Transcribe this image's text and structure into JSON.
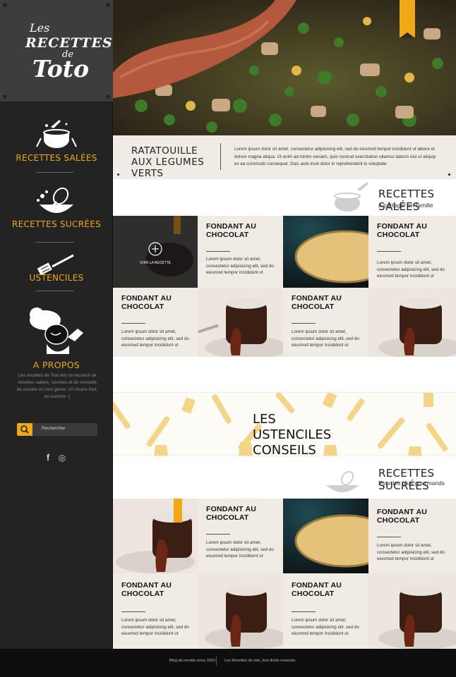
{
  "sidebar": {
    "logo": {
      "line1": "Les",
      "line2": "RECETTES",
      "line3": "de",
      "line4": "Toto"
    },
    "nav": [
      {
        "label": "RECETTES SALÉES",
        "icon": "cooking-pot-icon"
      },
      {
        "label": "RECETTES SUCRÉES",
        "icon": "whisk-bowl-icon"
      },
      {
        "label": "USTENCILES",
        "icon": "spatula-icon"
      },
      {
        "label": "A PROPOS",
        "icon": "chef-icon"
      }
    ],
    "about_text": "Les recettes de Toto est un recceuil de recettes salées, sucrées et de conseils de cuisine en tout genre. Un fourre tout, en somme :)",
    "search": {
      "placeholder": "Rechercher",
      "icon": "search-icon"
    },
    "social": [
      {
        "name": "facebook-icon",
        "glyph": "f"
      },
      {
        "name": "instagram-icon",
        "glyph": "◎"
      }
    ]
  },
  "feature": {
    "title": "RATATOUILLE AUX LEGUMES VERTS",
    "desc": "Lorem ipsum dolor sit amet, consectetur adipisicing elit, sed do eiusmod tempor incididunt ut labore et dolore magna aliqua. Ut enim ad minim veniam, quis nostrud exercitation ullamco laboris nisi ut aliquip ex ea commodo consequat. Duis aute irure dolor in reprehenderit in voluptate"
  },
  "sections": {
    "salees": {
      "title": "RECETTES SALÉES",
      "subtitle": "à partager en famille"
    },
    "ustenciles": {
      "title": "LES USTENCILES CONSEILS"
    },
    "sucrees": {
      "title": "RECETTES SUCRÉES",
      "subtitle": "Pour les plus gourmands"
    }
  },
  "hover_label": "VOIR LA RECETTE",
  "card": {
    "title": "FONDANT AU CHOCOLAT",
    "text": "Lorem ipsum dolor sit amet, consectetur adipisicing elit, sed do eiusmod tempor incididunt ut"
  },
  "footer": {
    "left": "Blog de recette since 2015",
    "right": "Les Recettes de toto, tout droits reservés"
  },
  "colors": {
    "accent": "#f0a818",
    "sidebar": "#232323",
    "card_bg": "#f1ece3"
  }
}
